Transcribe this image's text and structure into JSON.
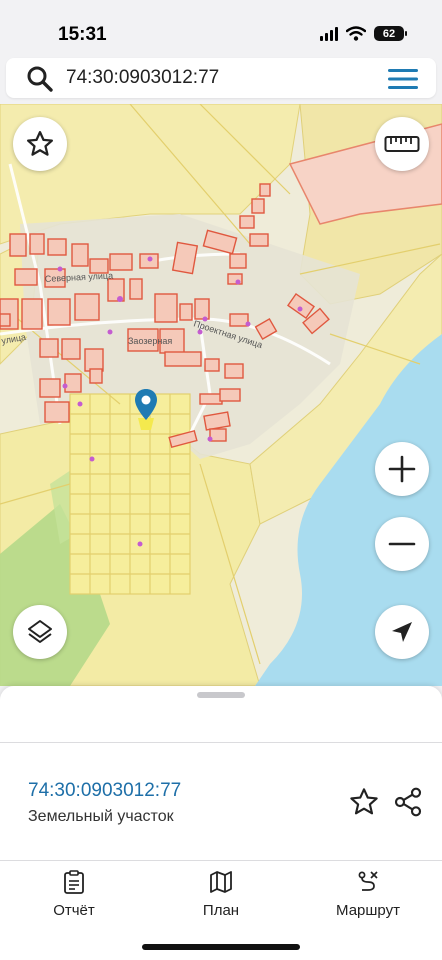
{
  "status": {
    "time": "15:31",
    "battery": "62"
  },
  "search": {
    "query": "74:30:0903012:77"
  },
  "map": {
    "street_labels": [
      "Северная улица",
      "улица",
      "Проектная улица",
      "Заозерная"
    ],
    "colors": {
      "water": "#a9dcef",
      "land": "#ebe7d9",
      "parcel_yellow": "#f5ed9f",
      "building_outline": "#e0583f",
      "pin": "#1f7bb3"
    }
  },
  "sheet": {
    "parcel_number": "74:30:0903012:77",
    "parcel_type": "Земельный участок"
  },
  "tabs": [
    {
      "label": "Отчёт",
      "icon": "clipboard-icon"
    },
    {
      "label": "План",
      "icon": "map-icon"
    },
    {
      "label": "Маршрут",
      "icon": "route-icon"
    }
  ]
}
